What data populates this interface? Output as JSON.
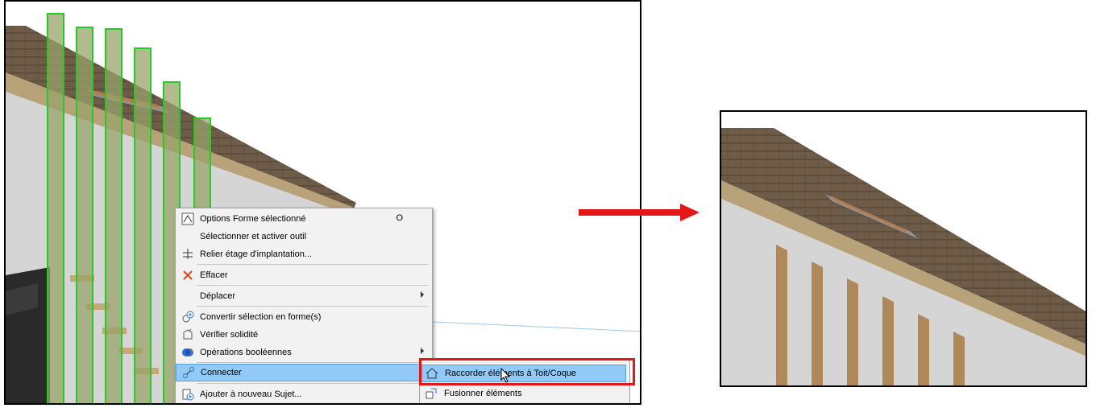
{
  "context_menu": {
    "items": [
      {
        "label": "Options Forme sélectionné",
        "shortcut": "O",
        "icon": "options-form-icon"
      },
      {
        "label": "Sélectionner et activer outil",
        "icon": ""
      },
      {
        "label": "Relier étage d'implantation...",
        "icon": "link-storey-icon"
      },
      {
        "label": "Effacer",
        "icon": "delete-x-icon"
      },
      {
        "label": "Déplacer",
        "icon": "",
        "submenu": true
      },
      {
        "label": "Convertir sélection en forme(s)",
        "icon": "convert-shape-icon"
      },
      {
        "label": "Vérifier solidité",
        "icon": "check-solid-icon"
      },
      {
        "label": "Opérations booléennes",
        "icon": "boolean-ops-icon",
        "submenu": true
      },
      {
        "label": "Connecter",
        "icon": "connect-icon",
        "submenu": true,
        "selected": true
      },
      {
        "label": "Ajouter à nouveau Sujet...",
        "icon": "add-topic-icon"
      }
    ]
  },
  "sub_menu": {
    "items": [
      {
        "label": "Raccorder éléments à Toit/Coque",
        "icon": "roof-trim-icon",
        "selected": true
      },
      {
        "label": "Fusionner éléments",
        "icon": "merge-elements-icon"
      }
    ]
  },
  "colors": {
    "highlight_box": "#e51616",
    "arrow": "#e51616",
    "menu_selected": "#91c9f7",
    "selection_outline": "#22cc22",
    "roof": "#6b5a47",
    "wall": "#d6d6d6"
  }
}
